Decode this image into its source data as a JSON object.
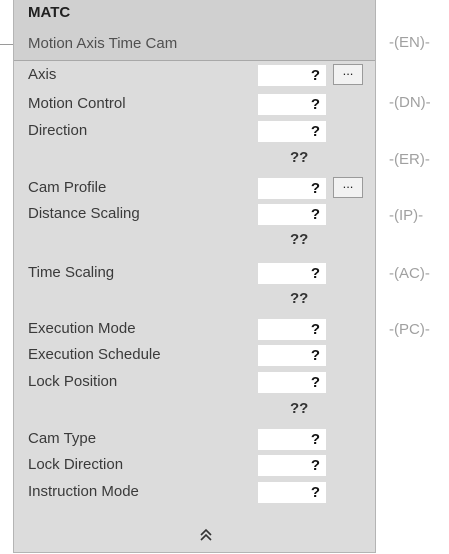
{
  "instruction": {
    "mnemonic": "MATC",
    "title": "Motion Axis Time Cam",
    "expand_icon": "double-chevron-up-icon"
  },
  "operands": [
    {
      "label": "Axis",
      "value": "?",
      "browse": "..."
    },
    {
      "label": "Motion Control",
      "value": "?"
    },
    {
      "label": "Direction",
      "value": "?",
      "extra": "??"
    },
    {
      "label": "Cam Profile",
      "value": "?",
      "browse": "..."
    },
    {
      "label": "Distance Scaling",
      "value": "?",
      "extra": "??"
    },
    {
      "label": "Time Scaling",
      "value": "?",
      "extra": "??"
    },
    {
      "label": "Execution Mode",
      "value": "?"
    },
    {
      "label": "Execution Schedule",
      "value": "?"
    },
    {
      "label": "Lock Position",
      "value": "?",
      "extra": "??"
    },
    {
      "label": "Cam Type",
      "value": "?"
    },
    {
      "label": "Lock Direction",
      "value": "?"
    },
    {
      "label": "Instruction Mode",
      "value": "?"
    }
  ],
  "output_bits": [
    "EN",
    "DN",
    "ER",
    "IP",
    "AC",
    "PC"
  ],
  "coil_text": {
    "EN": "-(EN)-",
    "DN": "-(DN)-",
    "ER": "-(ER)-",
    "IP": "-(IP)-",
    "AC": "-(AC)-",
    "PC": "-(PC)-"
  }
}
